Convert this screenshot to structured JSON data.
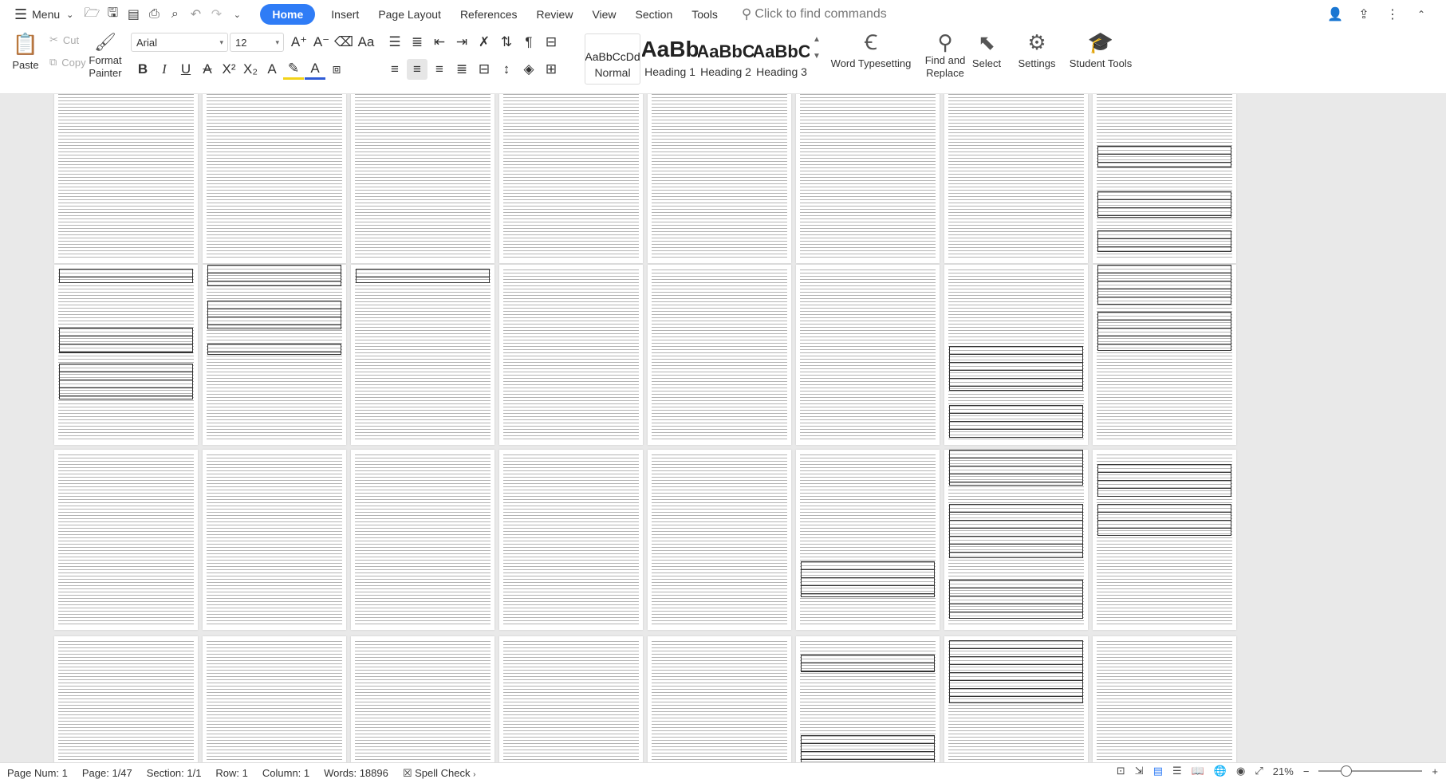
{
  "menubar": {
    "menu_label": "Menu",
    "tabs": [
      "Home",
      "Insert",
      "Page Layout",
      "References",
      "Review",
      "View",
      "Section",
      "Tools"
    ],
    "search_placeholder": "Click to find commands"
  },
  "ribbon": {
    "paste": "Paste",
    "cut": "Cut",
    "copy": "Copy",
    "format_painter": [
      "Format",
      "Painter"
    ],
    "font_name": "Arial",
    "font_size": "12",
    "styles": [
      {
        "sample": "AaBbCcDd",
        "name": "Normal"
      },
      {
        "sample": "AaBb",
        "name": "Heading 1"
      },
      {
        "sample": "AaBbC",
        "name": "Heading 2"
      },
      {
        "sample": "AaBbC",
        "name": "Heading 3"
      }
    ],
    "word_typesetting": "Word Typesetting",
    "find_replace": [
      "Find and",
      "Replace"
    ],
    "select": "Select",
    "settings": "Settings",
    "student_tools": "Student Tools"
  },
  "statusbar": {
    "page_num": "Page Num: 1",
    "page": "Page: 1/47",
    "section": "Section: 1/1",
    "row": "Row: 1",
    "column": "Column: 1",
    "words": "Words: 18896",
    "spell_check": "Spell Check",
    "zoom": "21%"
  },
  "colors": {
    "accent": "#2f7cf6",
    "font_color_bar": "#2f5bd6",
    "highlight_bar": "#f3d318"
  }
}
